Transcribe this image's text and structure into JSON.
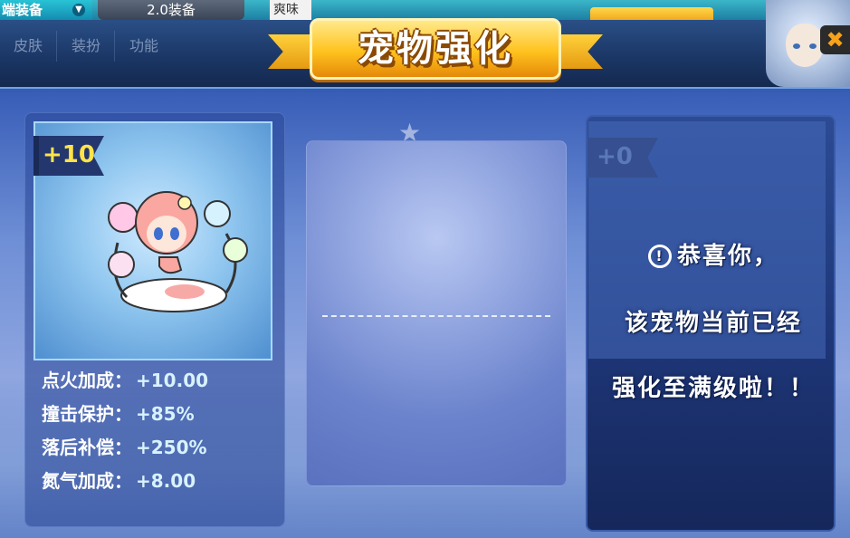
{
  "top_bar": {
    "tab1_label": "端装备",
    "tab2_label": "2.0装备",
    "tab3_label": "爽味"
  },
  "background_tabs": [
    "皮肤",
    "装扮",
    "功能"
  ],
  "dialog": {
    "title": "宠物强化",
    "close_glyph": "✖"
  },
  "left_panel": {
    "level": "+10",
    "stats": [
      {
        "label": "点火加成：",
        "value": "+10.00"
      },
      {
        "label": "撞击保护：",
        "value": "+85%"
      },
      {
        "label": "落后补偿：",
        "value": "+250%"
      },
      {
        "label": "氮气加成：",
        "value": "+8.00"
      }
    ]
  },
  "right_panel": {
    "level": "+0",
    "message_line1": "恭喜你，",
    "message_line2": "该宠物当前已经",
    "message_line3": "强化至满级啦！！",
    "icon": "exclamation-circle-icon"
  },
  "colors": {
    "accent_gold": "#ffc21e",
    "level_text": "#ffe34a",
    "panel_blue": "#2c4b94"
  }
}
